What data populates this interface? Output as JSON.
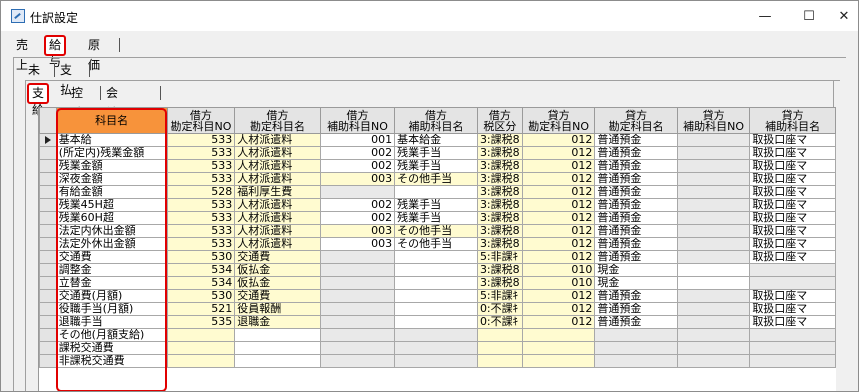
{
  "window": {
    "title": "仕訳設定",
    "min": "—",
    "max": "☐",
    "close": "✕"
  },
  "tabs_top": [
    {
      "label": "売上",
      "selected": false
    },
    {
      "label": "給与",
      "selected": true
    },
    {
      "label": "原価",
      "selected": false
    }
  ],
  "tabs_second": [
    {
      "label": "未払",
      "selected": false
    },
    {
      "label": "支払",
      "selected": false
    }
  ],
  "tabs_third": [
    {
      "label": "支給",
      "selected": true
    },
    {
      "label": "控除",
      "selected": false
    },
    {
      "label": "会社負担",
      "selected": false
    }
  ],
  "columns": [
    {
      "l1": "",
      "l2": "科目名"
    },
    {
      "l1": "借方",
      "l2": "勘定科目NO"
    },
    {
      "l1": "借方",
      "l2": "勘定科目名"
    },
    {
      "l1": "借方",
      "l2": "補助科目NO"
    },
    {
      "l1": "借方",
      "l2": "補助科目名"
    },
    {
      "l1": "借方",
      "l2": "税区分"
    },
    {
      "l1": "貸方",
      "l2": "勘定科目NO"
    },
    {
      "l1": "貸方",
      "l2": "勘定科目名"
    },
    {
      "l1": "貸方",
      "l2": "補助科目NO"
    },
    {
      "l1": "貸方",
      "l2": "補助科目名"
    }
  ],
  "rows": [
    [
      "基本給",
      "533",
      "人材派遣料",
      "001",
      "基本給金",
      "3:課税8",
      "012",
      "普通預金",
      "",
      "取扱口座マ"
    ],
    [
      "(所定内)残業金額",
      "533",
      "人材派遣料",
      "002",
      "残業手当",
      "3:課税8",
      "012",
      "普通預金",
      "",
      "取扱口座マ"
    ],
    [
      "残業金額",
      "533",
      "人材派遣料",
      "002",
      "残業手当",
      "3:課税8",
      "012",
      "普通預金",
      "",
      "取扱口座マ"
    ],
    [
      "深夜金額",
      "533",
      "人材派遣料",
      "003",
      "その他手当",
      "3:課税8",
      "012",
      "普通預金",
      "",
      "取扱口座マ"
    ],
    [
      "有給金額",
      "528",
      "福利厚生費",
      "",
      "",
      "3:課税8",
      "012",
      "普通預金",
      "",
      "取扱口座マ"
    ],
    [
      "残業45H超",
      "533",
      "人材派遣料",
      "002",
      "残業手当",
      "3:課税8",
      "012",
      "普通預金",
      "",
      "取扱口座マ"
    ],
    [
      "残業60H超",
      "533",
      "人材派遣料",
      "002",
      "残業手当",
      "3:課税8",
      "012",
      "普通預金",
      "",
      "取扱口座マ"
    ],
    [
      "法定内休出金額",
      "533",
      "人材派遣料",
      "003",
      "その他手当",
      "3:課税8",
      "012",
      "普通預金",
      "",
      "取扱口座マ"
    ],
    [
      "法定外休出金額",
      "533",
      "人材派遣料",
      "003",
      "その他手当",
      "3:課税8",
      "012",
      "普通預金",
      "",
      "取扱口座マ"
    ],
    [
      "交通費",
      "530",
      "交通費",
      "",
      "",
      "5:非課ｷ",
      "012",
      "普通預金",
      "",
      "取扱口座マ"
    ],
    [
      "調整金",
      "534",
      "仮払金",
      "",
      "",
      "3:課税8",
      "010",
      "現金",
      "",
      ""
    ],
    [
      "立替金",
      "534",
      "仮払金",
      "",
      "",
      "3:課税8",
      "010",
      "現金",
      "",
      ""
    ],
    [
      "交通費(月額)",
      "530",
      "交通費",
      "",
      "",
      "5:非課ｷ",
      "012",
      "普通預金",
      "",
      "取扱口座マ"
    ],
    [
      "役職手当(月額)",
      "521",
      "役員報酬",
      "",
      "",
      "0:不課ｷ",
      "012",
      "普通預金",
      "",
      "取扱口座マ"
    ],
    [
      "退職手当",
      "535",
      "退職金",
      "",
      "",
      "0:不課ｷ",
      "012",
      "普通預金",
      "",
      "取扱口座マ"
    ],
    [
      "その他(月額支給)",
      "",
      "",
      "",
      "",
      "",
      "",
      "",
      "",
      ""
    ],
    [
      "課税交通費",
      "",
      "",
      "",
      "",
      "",
      "",
      "",
      "",
      ""
    ],
    [
      "非課税交通費",
      "",
      "",
      "",
      "",
      "",
      "",
      "",
      "",
      ""
    ]
  ]
}
